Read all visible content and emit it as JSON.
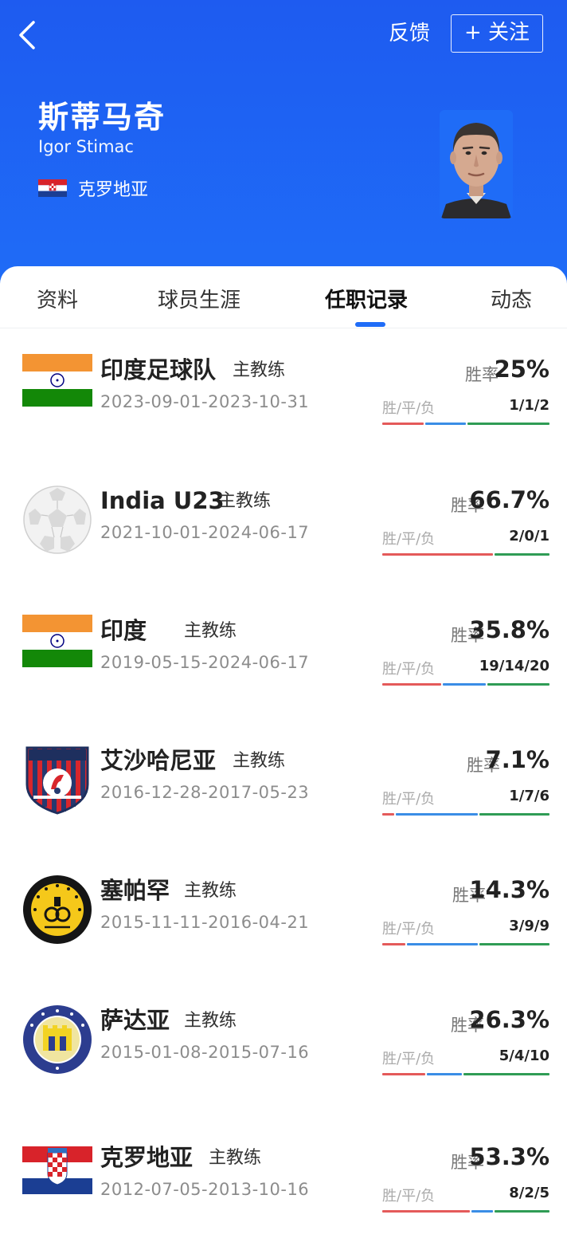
{
  "header": {
    "feedback_label": "反馈",
    "follow_label": "+ 关注",
    "name_cn": "斯蒂马奇",
    "name_en": "Igor Stimac",
    "nationality": "克罗地亚"
  },
  "tabs": [
    {
      "label": "资料"
    },
    {
      "label": "球员生涯"
    },
    {
      "label": "任职记录"
    },
    {
      "label": "动态"
    }
  ],
  "records": [
    {
      "team": "印度足球队",
      "role": "主教练",
      "dates": "2023-09-01-2023-10-31",
      "rate_label": "胜率",
      "rate": "25%",
      "wdl_label": "胜/平/负",
      "wdl": "1/1/2",
      "logo": "india-flag-icon"
    },
    {
      "team": "India U23",
      "role": "主教练",
      "dates": "2021-10-01-2024-06-17",
      "rate_label": "胜率",
      "rate": "66.7%",
      "wdl_label": "胜/平/负",
      "wdl": "2/0/1",
      "logo": "football-icon"
    },
    {
      "team": "印度",
      "role": "主教练",
      "dates": "2019-05-15-2024-06-17",
      "rate_label": "胜率",
      "rate": "35.8%",
      "wdl_label": "胜/平/负",
      "wdl": "19/14/20",
      "logo": "india-flag-icon"
    },
    {
      "team": "艾沙哈尼亚",
      "role": "主教练",
      "dates": "2016-12-28-2017-05-23",
      "rate_label": "胜率",
      "rate": "7.1%",
      "wdl_label": "胜/平/负",
      "wdl": "1/7/6",
      "logo": "al-shahania-crest-icon"
    },
    {
      "team": "塞帕罕",
      "role": "主教练",
      "dates": "2015-11-11-2016-04-21",
      "rate_label": "胜率",
      "rate": "14.3%",
      "wdl_label": "胜/平/负",
      "wdl": "3/9/9",
      "logo": "sepahan-crest-icon"
    },
    {
      "team": "萨达亚",
      "role": "主教练",
      "dates": "2015-01-08-2015-07-16",
      "rate_label": "胜率",
      "rate": "26.3%",
      "wdl_label": "胜/平/负",
      "wdl": "5/4/10",
      "logo": "nk-zadar-crest-icon"
    },
    {
      "team": "克罗地亚",
      "role": "主教练",
      "dates": "2012-07-05-2013-10-16",
      "rate_label": "胜率",
      "rate": "53.3%",
      "wdl_label": "胜/平/负",
      "wdl": "8/2/5",
      "logo": "croatia-flag-icon"
    }
  ],
  "colors": {
    "header_blue": "#1f6cf7",
    "win": "#e45a5a",
    "draw": "#3a8de6",
    "loss": "#2f9c55"
  }
}
